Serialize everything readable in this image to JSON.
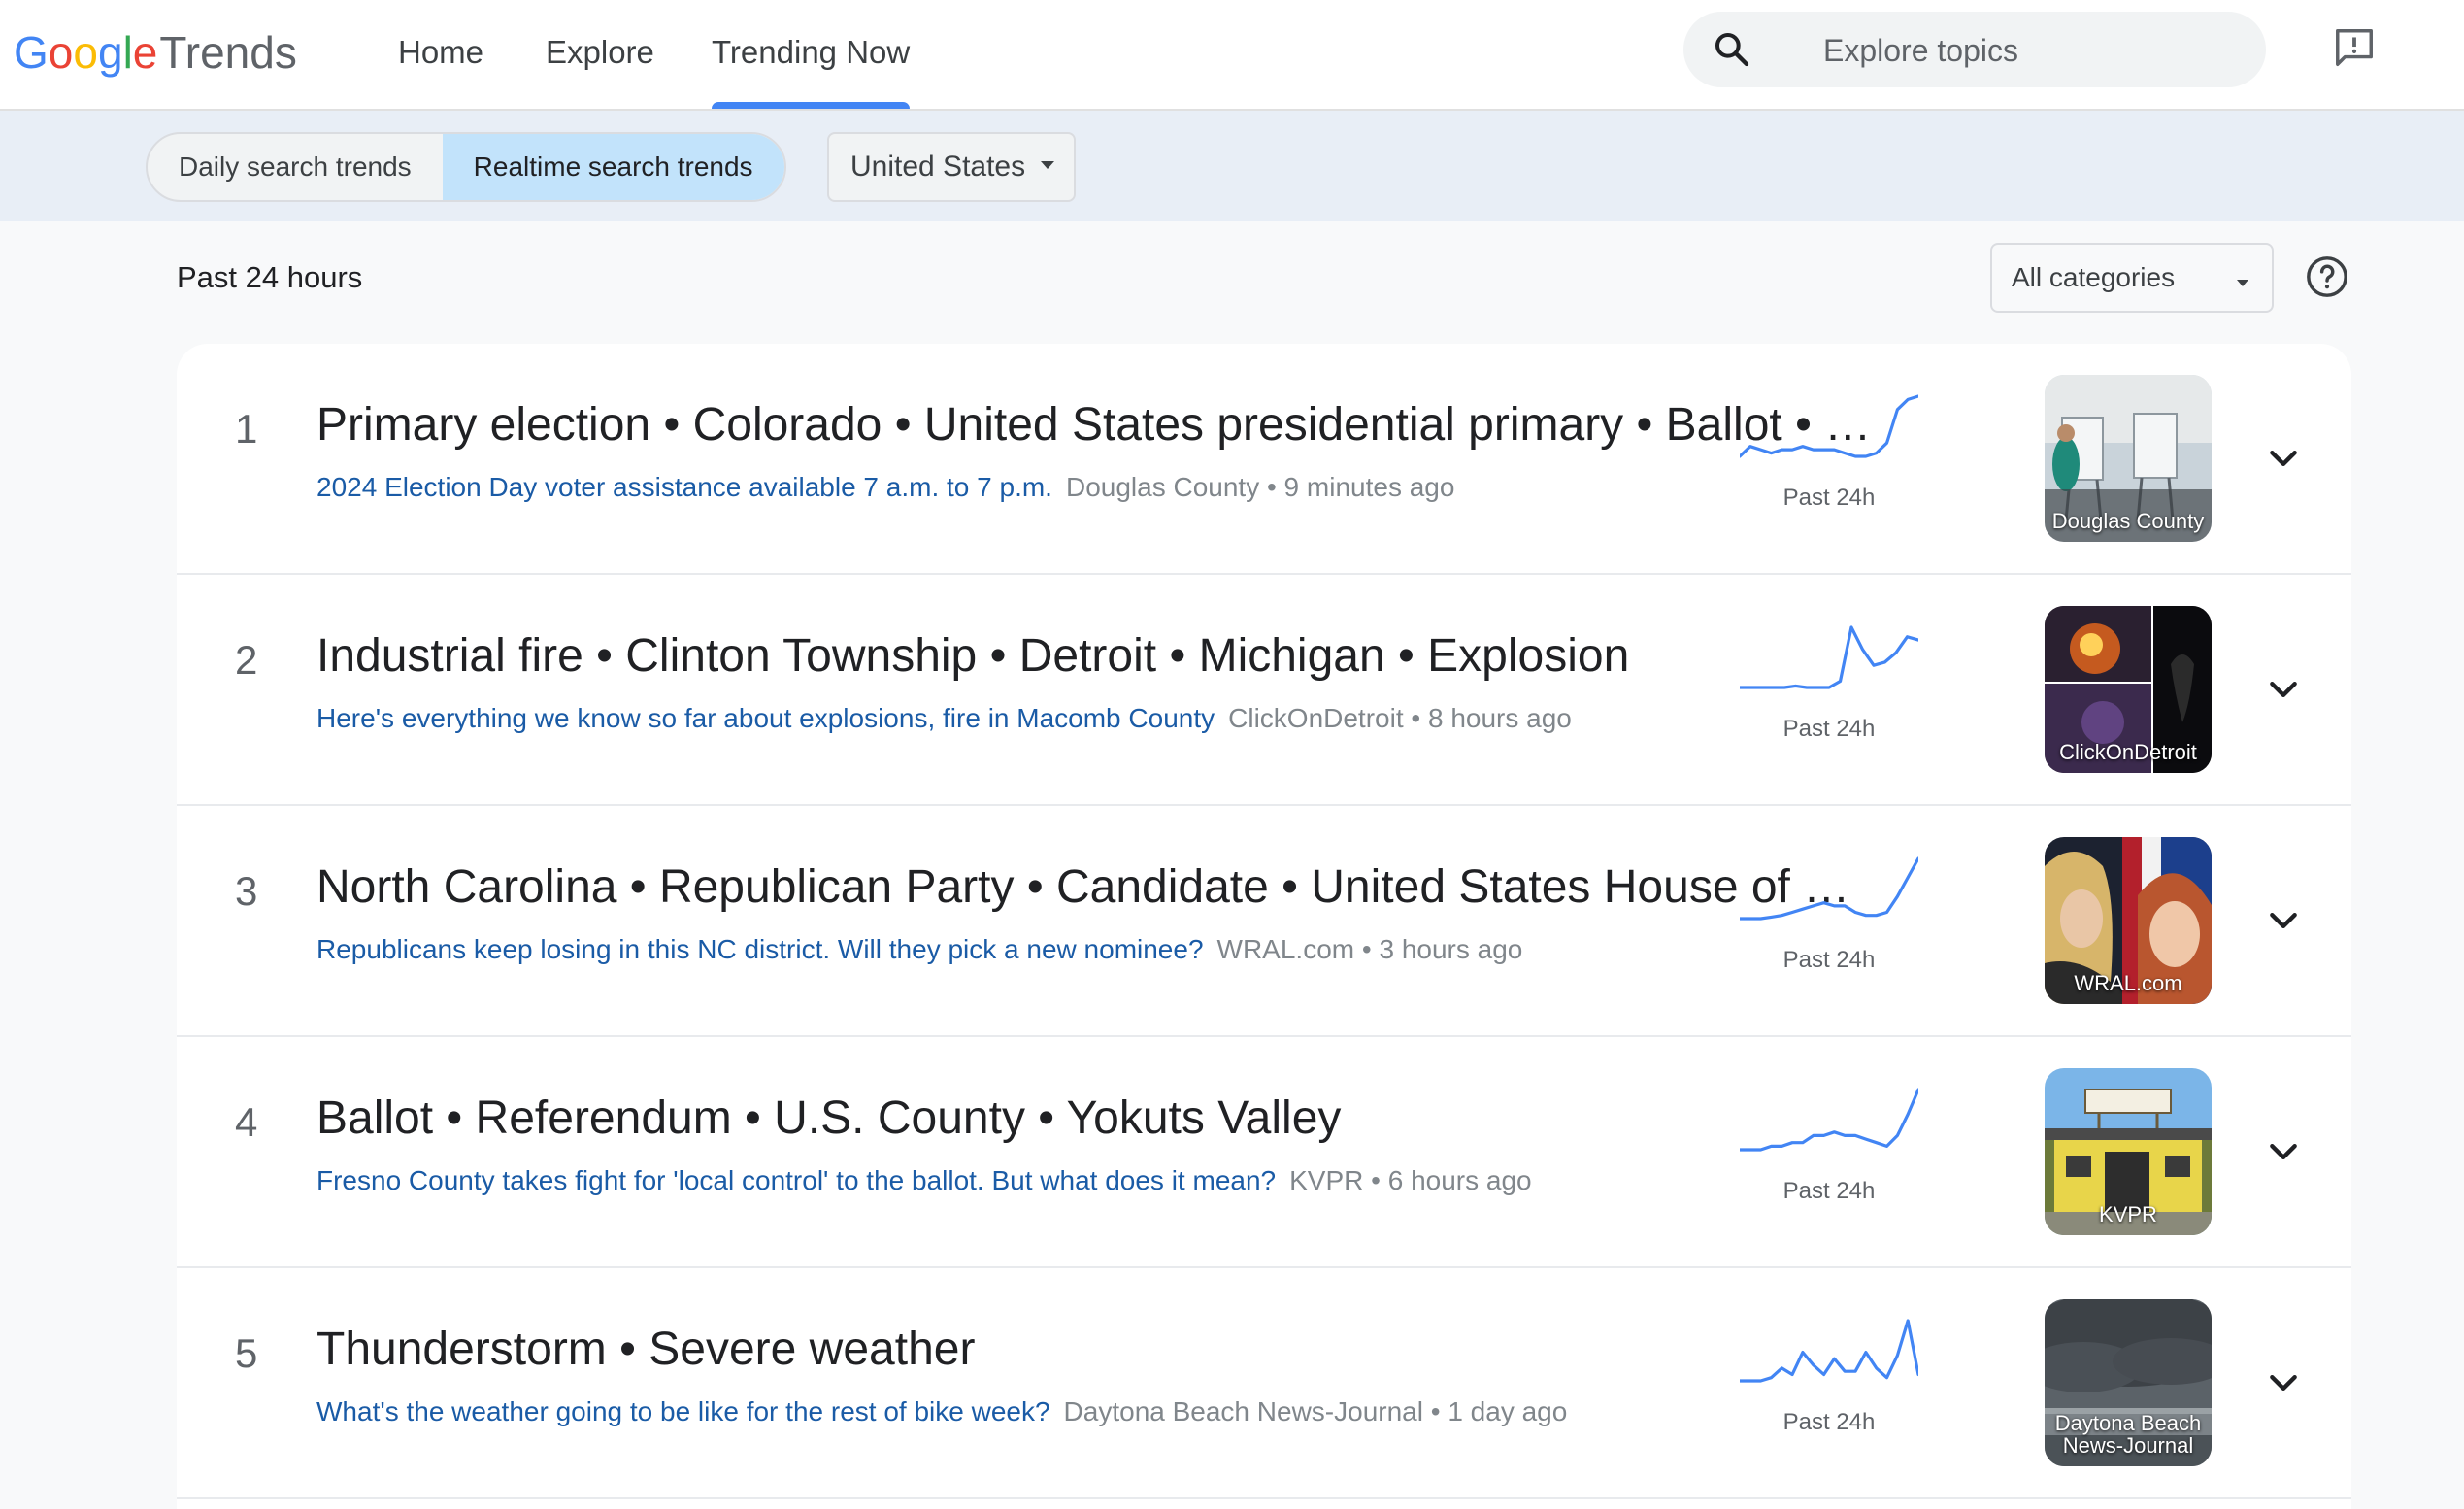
{
  "header": {
    "logo_google": [
      "G",
      "o",
      "o",
      "g",
      "l",
      "e"
    ],
    "logo_trends": "Trends",
    "nav": [
      {
        "label": "Home"
      },
      {
        "label": "Explore"
      },
      {
        "label": "Trending Now"
      }
    ],
    "search": {
      "placeholder": "Explore topics"
    }
  },
  "colors": {
    "google_blue": "#4285f4",
    "google_red": "#ea4335",
    "google_yellow": "#fbbc05",
    "google_green": "#34a853",
    "link_blue": "#1a5ba6",
    "active_segment": "#c2e3fb"
  },
  "subheader": {
    "segments": [
      "Daily search trends",
      "Realtime search trends"
    ],
    "active_segment": "Realtime search trends",
    "region": "United States"
  },
  "filters": {
    "time_range": "Past 24 hours",
    "category": "All categories"
  },
  "trends": [
    {
      "rank": "1",
      "title": "Primary election • Colorado • United States presidential primary • Ballot • Super Tuesday",
      "article": "2024 Election Day voter assistance available 7 a.m. to 7 p.m.",
      "source": "Douglas County • 9 minutes ago",
      "spark_label": "Past 24h",
      "thumb_label": "Douglas County",
      "spark": [
        2,
        5,
        4,
        3,
        4,
        4,
        5,
        4,
        4,
        4,
        3,
        2,
        2,
        3,
        6,
        16,
        19,
        20
      ]
    },
    {
      "rank": "2",
      "title": "Industrial fire • Clinton Township • Detroit • Michigan • Explosion",
      "article": "Here's everything we know so far about explosions, fire in Macomb County",
      "source": "ClickOnDetroit • 8 hours ago",
      "spark_label": "Past 24h",
      "thumb_label": "ClickOnDetroit",
      "spark": [
        1,
        1,
        1,
        1,
        1,
        1.5,
        1,
        1,
        1,
        3,
        20,
        13,
        8,
        9,
        12,
        17,
        16
      ]
    },
    {
      "rank": "3",
      "title": "North Carolina • Republican Party • Candidate • United States House of Representatives",
      "article": "Republicans keep losing in this NC district. Will they pick a new nominee?",
      "source": "WRAL.com • 3 hours ago",
      "spark_label": "Past 24h",
      "thumb_label": "WRAL.com",
      "spark": [
        1,
        1,
        1,
        1.5,
        2,
        3,
        4,
        5,
        6,
        5,
        5,
        3,
        2,
        2,
        3,
        8,
        14,
        20
      ]
    },
    {
      "rank": "4",
      "title": "Ballot • Referendum • U.S. County • Yokuts Valley",
      "article": "Fresno County takes fight for 'local control' to the ballot. But what does it mean?",
      "source": "KVPR • 6 hours ago",
      "spark_label": "Past 24h",
      "thumb_label": "KVPR",
      "spark": [
        2,
        2,
        2,
        3,
        3,
        4,
        4,
        6,
        6,
        7,
        6,
        6,
        5,
        4,
        3,
        6,
        12,
        19
      ]
    },
    {
      "rank": "5",
      "title": "Thunderstorm • Severe weather",
      "article": "What's the weather going to be like for the rest of bike week?",
      "source": "Daytona Beach News-Journal • 1 day ago",
      "spark_label": "Past 24h",
      "thumb_label": "Daytona Beach News-Journal",
      "spark": [
        1,
        1,
        1,
        2,
        5,
        3,
        10,
        6,
        3,
        8,
        4,
        4,
        10,
        5,
        2,
        9,
        20,
        3
      ]
    }
  ]
}
